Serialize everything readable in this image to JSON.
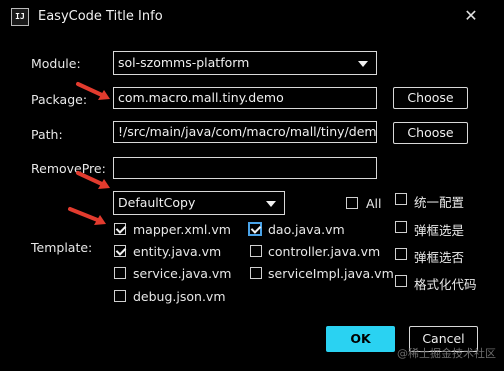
{
  "window": {
    "title": "EasyCode Title Info",
    "app_icon_text": "IJ"
  },
  "form": {
    "module_label": "Module:",
    "module_value": "sol-szomms-platform",
    "package_label": "Package:",
    "package_value": "com.macro.mall.tiny.demo",
    "path_label": "Path:",
    "path_value": "!/src/main/java/com/macro/mall/tiny/demo",
    "removepre_label": "RemovePre:",
    "removepre_value": "",
    "choose_label": "Choose",
    "group_value": "DefaultCopy",
    "all_label": "All",
    "template_label": "Template:"
  },
  "templates": [
    {
      "label": "mapper.xml.vm",
      "checked": true
    },
    {
      "label": "dao.java.vm",
      "checked": true
    },
    {
      "label": "entity.java.vm",
      "checked": true
    },
    {
      "label": "controller.java.vm",
      "checked": false
    },
    {
      "label": "service.java.vm",
      "checked": false
    },
    {
      "label": "serviceImpl.java.vm",
      "checked": false
    },
    {
      "label": "debug.json.vm",
      "checked": false
    }
  ],
  "options": [
    {
      "label": "统一配置",
      "checked": false
    },
    {
      "label": "弹框选是",
      "checked": false
    },
    {
      "label": "弹框选否",
      "checked": false
    },
    {
      "label": "格式化代码",
      "checked": false
    }
  ],
  "buttons": {
    "ok": "OK",
    "cancel": "Cancel"
  },
  "watermark": "@稀土掘金技术社区",
  "colors": {
    "accent": "#2ad2f2",
    "annotation_arrow": "#e23b2e",
    "focus": "#4aa3e8"
  }
}
